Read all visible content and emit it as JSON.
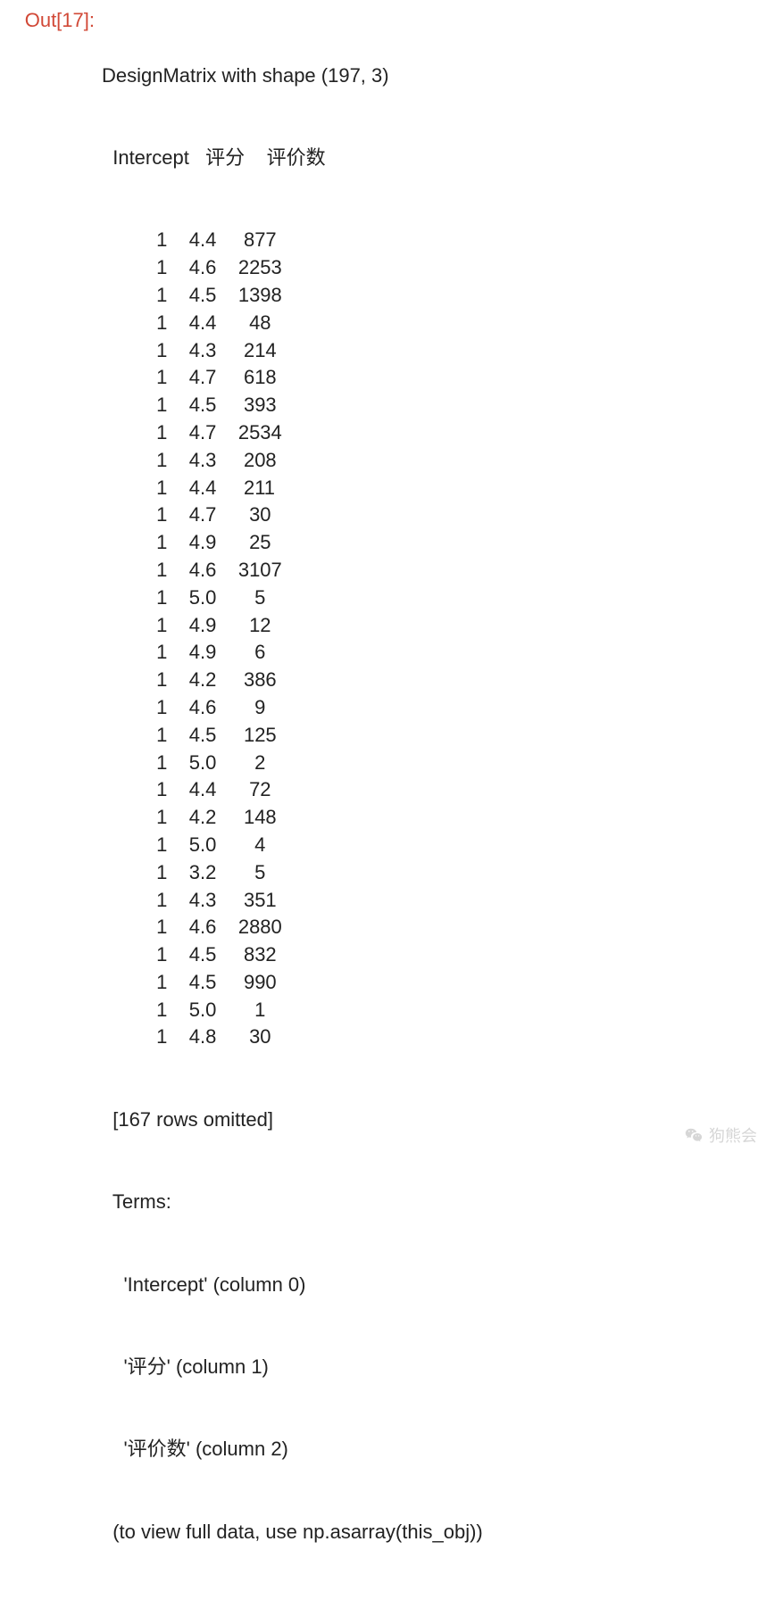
{
  "output": {
    "prompt": "Out[17]:",
    "title_line": "DesignMatrix with shape (197, 3)",
    "columns": [
      "Intercept",
      "评分",
      "评价数"
    ],
    "header_line": "  Intercept   评分    评价数",
    "rows": [
      {
        "intercept": "1",
        "rating": "4.4",
        "count": "877"
      },
      {
        "intercept": "1",
        "rating": "4.6",
        "count": "2253"
      },
      {
        "intercept": "1",
        "rating": "4.5",
        "count": "1398"
      },
      {
        "intercept": "1",
        "rating": "4.4",
        "count": "48"
      },
      {
        "intercept": "1",
        "rating": "4.3",
        "count": "214"
      },
      {
        "intercept": "1",
        "rating": "4.7",
        "count": "618"
      },
      {
        "intercept": "1",
        "rating": "4.5",
        "count": "393"
      },
      {
        "intercept": "1",
        "rating": "4.7",
        "count": "2534"
      },
      {
        "intercept": "1",
        "rating": "4.3",
        "count": "208"
      },
      {
        "intercept": "1",
        "rating": "4.4",
        "count": "211"
      },
      {
        "intercept": "1",
        "rating": "4.7",
        "count": "30"
      },
      {
        "intercept": "1",
        "rating": "4.9",
        "count": "25"
      },
      {
        "intercept": "1",
        "rating": "4.6",
        "count": "3107"
      },
      {
        "intercept": "1",
        "rating": "5.0",
        "count": "5"
      },
      {
        "intercept": "1",
        "rating": "4.9",
        "count": "12"
      },
      {
        "intercept": "1",
        "rating": "4.9",
        "count": "6"
      },
      {
        "intercept": "1",
        "rating": "4.2",
        "count": "386"
      },
      {
        "intercept": "1",
        "rating": "4.6",
        "count": "9"
      },
      {
        "intercept": "1",
        "rating": "4.5",
        "count": "125"
      },
      {
        "intercept": "1",
        "rating": "5.0",
        "count": "2"
      },
      {
        "intercept": "1",
        "rating": "4.4",
        "count": "72"
      },
      {
        "intercept": "1",
        "rating": "4.2",
        "count": "148"
      },
      {
        "intercept": "1",
        "rating": "5.0",
        "count": "4"
      },
      {
        "intercept": "1",
        "rating": "3.2",
        "count": "5"
      },
      {
        "intercept": "1",
        "rating": "4.3",
        "count": "351"
      },
      {
        "intercept": "1",
        "rating": "4.6",
        "count": "2880"
      },
      {
        "intercept": "1",
        "rating": "4.5",
        "count": "832"
      },
      {
        "intercept": "1",
        "rating": "4.5",
        "count": "990"
      },
      {
        "intercept": "1",
        "rating": "5.0",
        "count": "1"
      },
      {
        "intercept": "1",
        "rating": "4.8",
        "count": "30"
      }
    ],
    "omitted_line": "  [167 rows omitted]",
    "terms_label": "  Terms:",
    "terms": [
      "    'Intercept' (column 0)",
      "    '评分' (column 1)",
      "    '评价数' (column 2)"
    ],
    "footer_line": "  (to view full data, use np.asarray(this_obj))"
  },
  "watermark": {
    "text": "狗熊会"
  }
}
